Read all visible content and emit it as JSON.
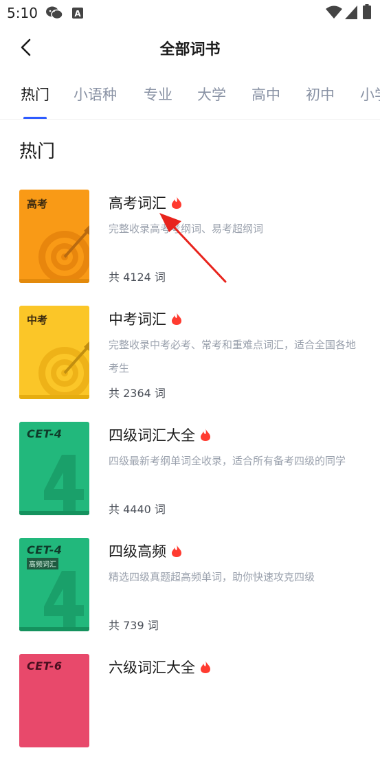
{
  "status_bar": {
    "time": "5:10"
  },
  "header": {
    "title": "全部词书"
  },
  "tabs": [
    {
      "label": "热门"
    },
    {
      "label": "小语种"
    },
    {
      "label": "专业"
    },
    {
      "label": "大学"
    },
    {
      "label": "高中"
    },
    {
      "label": "初中"
    },
    {
      "label": "小学"
    }
  ],
  "active_tab": "热门",
  "section": {
    "title": "热门"
  },
  "books": [
    {
      "cover_label": "高考",
      "name": "高考词汇",
      "desc": "完整收录高考考纲词、易考超纲词",
      "count": "共 4124 词",
      "cover_color": "#f99a16"
    },
    {
      "cover_label": "中考",
      "name": "中考词汇",
      "desc": "完整收录中考必考、常考和重难点词汇，适合全国各地考生",
      "count": "共 2364 词",
      "cover_color": "#fbc628"
    },
    {
      "cover_label": "CET-4",
      "name": "四级词汇大全",
      "desc": "四级最新考纲单词全收录，适合所有备考四级的同学",
      "count": "共 4440 词",
      "cover_color": "#22b87c"
    },
    {
      "cover_label": "CET-4",
      "cover_sub": "高频词汇",
      "name": "四级高频",
      "desc": "精选四级真题超高频单词，助你快速攻克四级",
      "count": "共 739 词",
      "cover_color": "#22b87c"
    },
    {
      "cover_label": "CET-6",
      "name": "六级词汇大全",
      "cover_color": "#e8496b"
    }
  ],
  "colors": {
    "accent": "#2e5bff",
    "hot": "#ff3b30",
    "annotation": "#e8241d"
  }
}
